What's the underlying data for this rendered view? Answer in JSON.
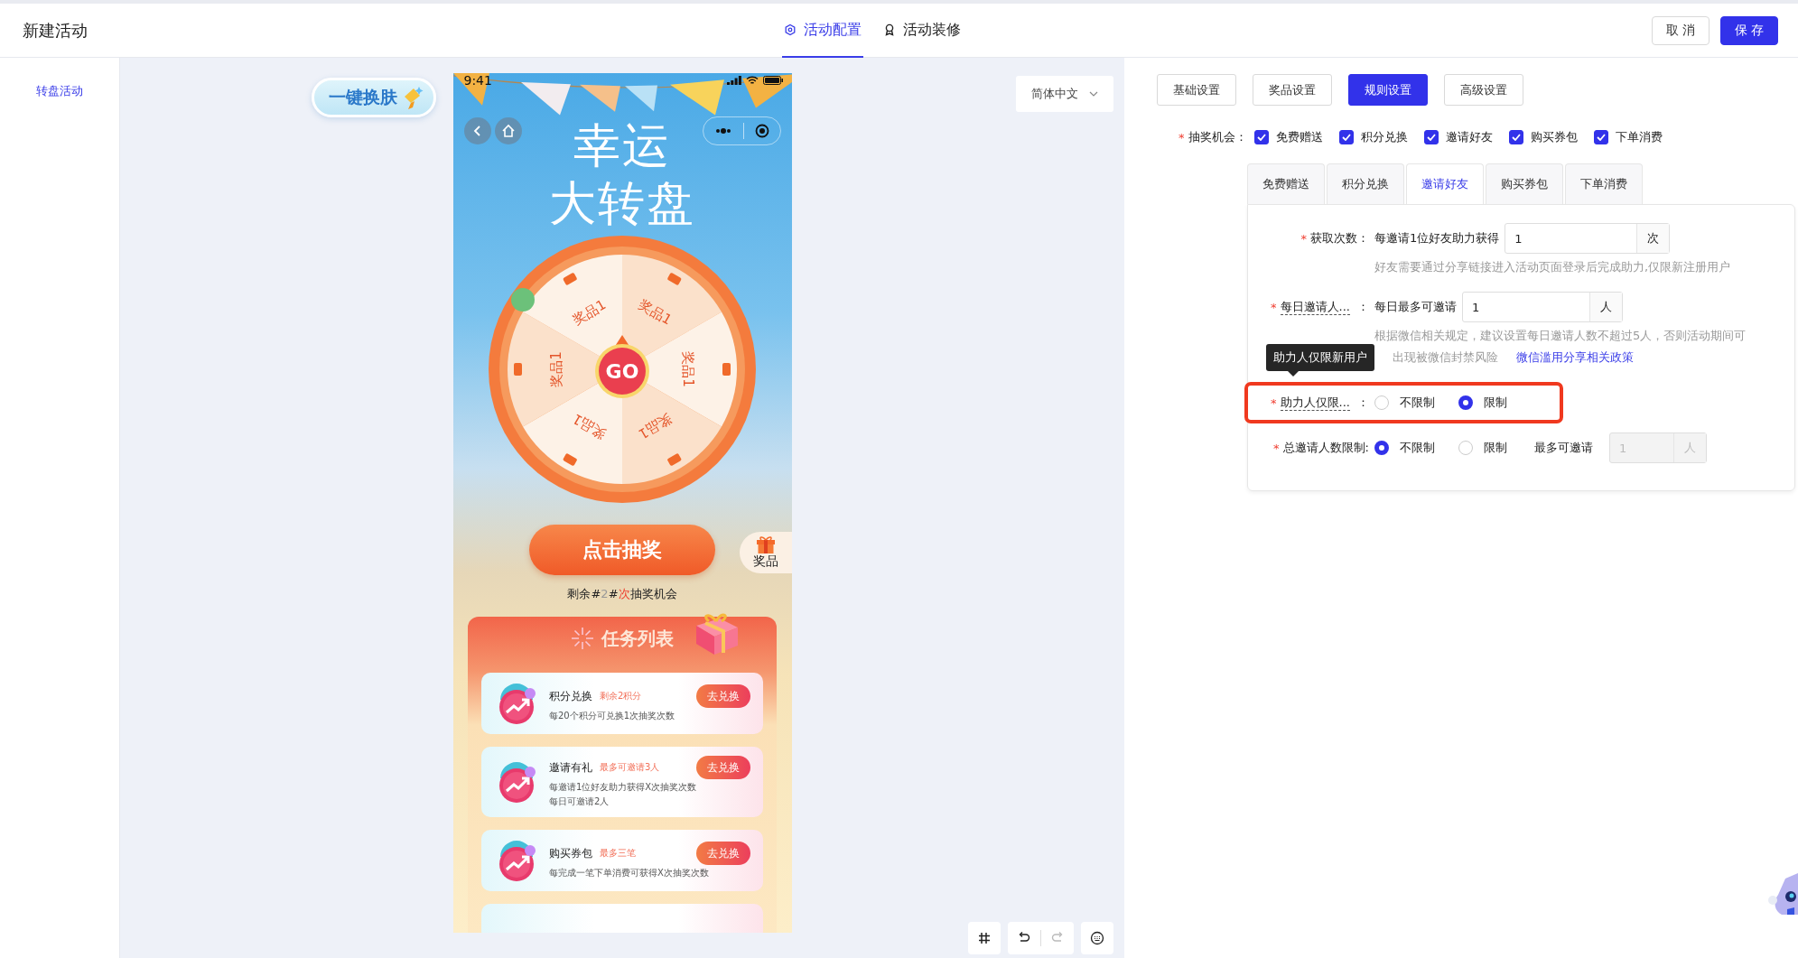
{
  "header": {
    "title": "新建活动",
    "tabs": [
      {
        "label": "活动配置",
        "selected": true
      },
      {
        "label": "活动装修",
        "selected": false
      }
    ],
    "buttons": [
      {
        "label": "取 消",
        "kind": "default"
      },
      {
        "label": "保 存",
        "kind": "primary"
      }
    ]
  },
  "sidebar": {
    "items": [
      {
        "label": "转盘活动",
        "selected": true
      }
    ]
  },
  "canvas": {
    "skin_button": "一键换肤",
    "language": "简体中文",
    "toolbar": [
      {
        "kind": "grid",
        "disabled": false
      },
      {
        "kind": "undo",
        "disabled": false
      },
      {
        "kind": "redo",
        "disabled": true
      },
      {
        "kind": "keyboard",
        "disabled": false
      }
    ]
  },
  "phone": {
    "time": "9:41",
    "title_lines": [
      "幸运",
      "大转盘"
    ],
    "wheel": {
      "center": "GO",
      "segments": [
        "奖品1",
        "奖品1",
        "奖品1",
        "奖品1",
        "奖品1",
        "奖品1"
      ]
    },
    "draw_button": "点击抽奖",
    "prizes_tab": "奖品",
    "remaining": [
      {
        "text": "剩余#",
        "color": "#222222"
      },
      {
        "text": "2",
        "color": "#999999"
      },
      {
        "text": "#",
        "color": "#222222"
      },
      {
        "text": "次",
        "color": "#ee3b2a"
      },
      {
        "text": "抽奖机会",
        "color": "#222222"
      }
    ],
    "tasks_title": "任务列表",
    "tasks": [
      {
        "title": "积分兑换",
        "badge": "剩余2积分",
        "lines": [
          "每20个积分可兑换1次抽奖次数"
        ],
        "button": "去兑换"
      },
      {
        "title": "邀请有礼",
        "badge": "最多可邀请3人",
        "lines": [
          "每邀请1位好友助力获得X次抽奖次数",
          "每日可邀请2人"
        ],
        "button": "去兑换"
      },
      {
        "title": "购买券包",
        "badge": "最多三笔",
        "lines": [
          "每完成一笔下单消费可获得X次抽奖次数"
        ],
        "button": "去兑换"
      }
    ]
  },
  "settings": {
    "tabs": [
      {
        "label": "基础设置",
        "selected": false
      },
      {
        "label": "奖品设置",
        "selected": false
      },
      {
        "label": "规则设置",
        "selected": true
      },
      {
        "label": "高级设置",
        "selected": false
      }
    ],
    "chances": {
      "required_mark": "*",
      "label": "抽奖机会：",
      "options": [
        {
          "label": "免费赠送",
          "checked": true
        },
        {
          "label": "积分兑换",
          "checked": true
        },
        {
          "label": "邀请好友",
          "checked": true
        },
        {
          "label": "购买券包",
          "checked": true
        },
        {
          "label": "下单消费",
          "checked": true
        }
      ]
    },
    "sub_tabs": [
      {
        "label": "免费赠送",
        "selected": false
      },
      {
        "label": "积分兑换",
        "selected": false
      },
      {
        "label": "邀请好友",
        "selected": true
      },
      {
        "label": "购买券包",
        "selected": false
      },
      {
        "label": "下单消费",
        "selected": false
      }
    ],
    "rows": [
      {
        "kind": "input",
        "required_mark": "*",
        "label": "获取次数：",
        "truncated": false,
        "prefix": "每邀请1位好友助力获得",
        "value": "1",
        "unit": "次",
        "hints": [
          "好友需要通过分享链接进入活动页面登录后完成助力,仅限新注册用户"
        ]
      },
      {
        "kind": "input",
        "required_mark": "*",
        "label": "每日邀请人...",
        "colon": "：",
        "truncated": true,
        "prefix": "每日最多可邀请",
        "value": "1",
        "unit": "人",
        "hints": [
          "根据微信相关规定，建议设置每日邀请人数不超过5人，否则活动期间可",
          "出现被微信封禁风险"
        ],
        "link": "微信滥用分享相关政策"
      },
      {
        "kind": "radio",
        "required_mark": "*",
        "label": "助力人仅限...",
        "colon": "：",
        "truncated": true,
        "highlighted": true,
        "tooltip": "助力人仅限新用户",
        "options": [
          {
            "label": "不限制",
            "selected": false
          },
          {
            "label": "限制",
            "selected": true
          }
        ]
      },
      {
        "kind": "radio",
        "required_mark": "*",
        "label": "总邀请人数限制:",
        "truncated": false,
        "highlighted": false,
        "options": [
          {
            "label": "不限制",
            "selected": true
          },
          {
            "label": "限制",
            "selected": false
          }
        ],
        "extra": {
          "label": "最多可邀请",
          "value": "1",
          "unit": "人",
          "disabled": true
        }
      }
    ]
  }
}
